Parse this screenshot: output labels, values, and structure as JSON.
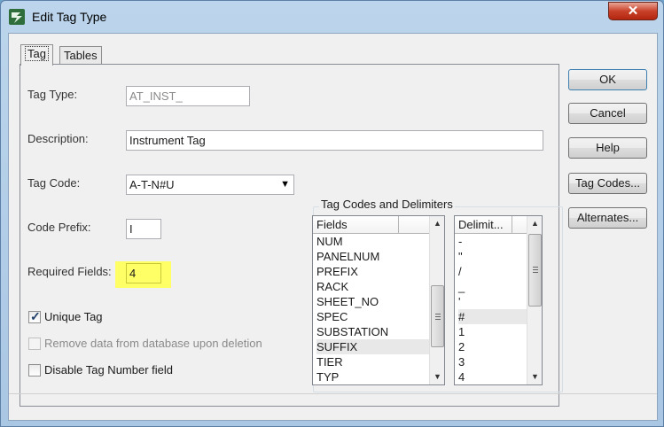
{
  "window": {
    "title": "Edit Tag Type",
    "close_glyph": "✕"
  },
  "tabs": [
    {
      "label": "Tag"
    },
    {
      "label": "Tables"
    }
  ],
  "form": {
    "tag_type_label": "Tag Type:",
    "tag_type_value": "AT_INST_",
    "description_label": "Description:",
    "description_value": "Instrument Tag",
    "tag_code_label": "Tag Code:",
    "tag_code_value": "A-T-N#U",
    "code_prefix_label": "Code Prefix:",
    "code_prefix_value": "I",
    "required_fields_label": "Required Fields:",
    "required_fields_value": "4",
    "unique_tag_label": "Unique Tag",
    "unique_tag_checked": true,
    "remove_data_label": "Remove data from database upon deletion",
    "remove_data_checked": false,
    "disable_tag_number_label": "Disable Tag Number field",
    "disable_tag_number_checked": false
  },
  "tag_codes_group": {
    "title": "Tag Codes and Delimiters",
    "fields_header": "Fields",
    "fields": [
      "NUM",
      "PANELNUM",
      "PREFIX",
      "RACK",
      "SHEET_NO",
      "SPEC",
      "SUBSTATION",
      "SUFFIX",
      "TIER",
      "TYP"
    ],
    "delimiters_header": "Delimit...",
    "delimiters": [
      "-",
      "\"",
      "/",
      "_",
      "'",
      "#",
      "1",
      "2",
      "3",
      "4"
    ]
  },
  "buttons": {
    "ok": "OK",
    "cancel": "Cancel",
    "help": "Help",
    "tag_codes": "Tag Codes...",
    "alternates": "Alternates..."
  },
  "colors": {
    "highlight": "#ffff66",
    "title_bar": "#bcd5ec",
    "close_button": "#c9412a"
  }
}
